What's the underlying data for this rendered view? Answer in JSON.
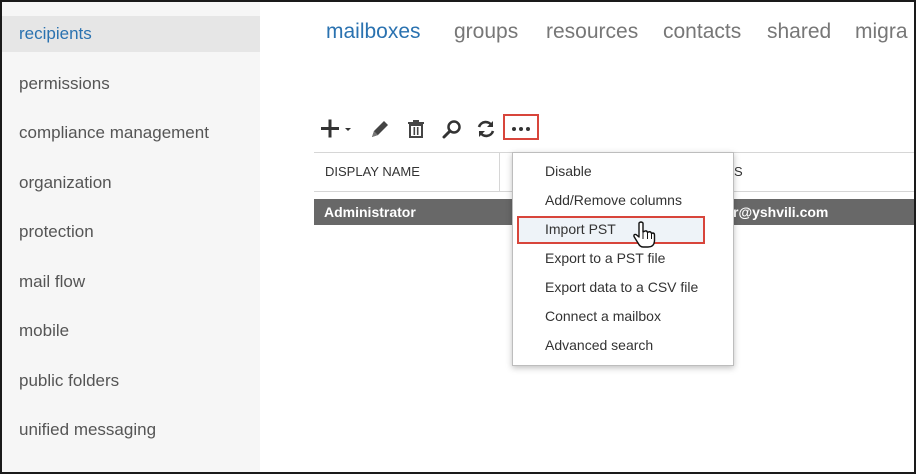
{
  "sidebar": {
    "items": [
      {
        "label": "recipients",
        "active": true
      },
      {
        "label": "permissions"
      },
      {
        "label": "compliance management"
      },
      {
        "label": "organization"
      },
      {
        "label": "protection"
      },
      {
        "label": "mail flow"
      },
      {
        "label": "mobile"
      },
      {
        "label": "public folders"
      },
      {
        "label": "unified messaging"
      }
    ]
  },
  "tabs": [
    {
      "label": "mailboxes",
      "active": true
    },
    {
      "label": "groups"
    },
    {
      "label": "resources"
    },
    {
      "label": "contacts"
    },
    {
      "label": "shared"
    },
    {
      "label": "migra"
    }
  ],
  "toolbar": {
    "icons": [
      "add-icon",
      "edit-icon",
      "delete-icon",
      "search-icon",
      "refresh-icon",
      "more-icon"
    ]
  },
  "table": {
    "columns": [
      "DISPLAY NAME",
      "S"
    ],
    "rows": [
      {
        "display_name": "Administrator",
        "email": "r@yshvili.com"
      }
    ]
  },
  "menu": {
    "items": [
      "Disable",
      "Add/Remove columns",
      "Import PST",
      "Export to a PST file",
      "Export data to a CSV file",
      "Connect a mailbox",
      "Advanced search"
    ]
  },
  "colors": {
    "accent": "#2a72b0",
    "highlight_border": "#d8453b",
    "selected_row": "#686868"
  }
}
